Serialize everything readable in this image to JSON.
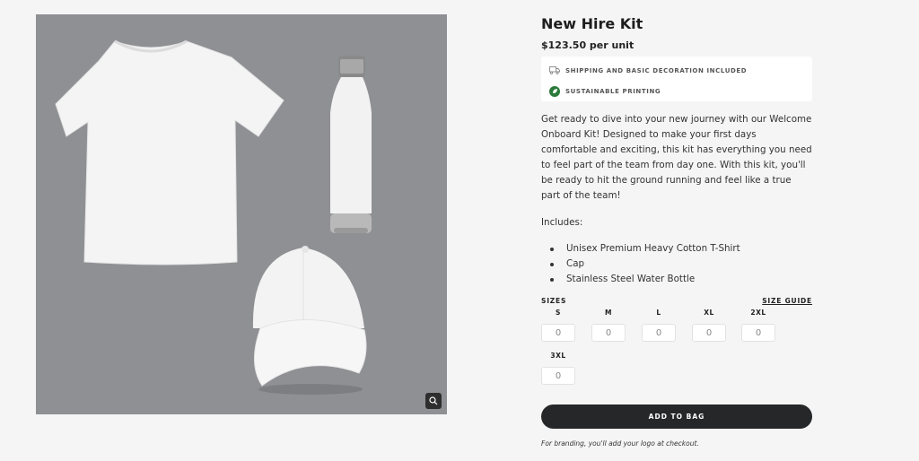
{
  "product": {
    "title": "New Hire Kit",
    "price": "$123.50 per unit",
    "image_bg": "#8f9094",
    "features": [
      {
        "icon": "truck-icon",
        "text": "SHIPPING AND BASIC DECORATION INCLUDED"
      },
      {
        "icon": "leaf-icon",
        "text": "SUSTAINABLE PRINTING"
      }
    ],
    "description": "Get ready to dive into your new journey with our Welcome Onboard Kit! Designed to make your first days comfortable and exciting, this kit has everything you need to feel part of the team from day one. With this kit, you'll be ready to hit the ground running and feel like a true part of the team!",
    "includes_label": "Includes:",
    "includes": [
      "Unisex Premium Heavy Cotton T-Shirt",
      "Cap",
      "Stainless Steel Water Bottle"
    ]
  },
  "sizes": {
    "label": "SIZES",
    "guide_label": "SIZE GUIDE",
    "options": [
      {
        "size": "S",
        "value": "0"
      },
      {
        "size": "M",
        "value": "0"
      },
      {
        "size": "L",
        "value": "0"
      },
      {
        "size": "XL",
        "value": "0"
      },
      {
        "size": "2XL",
        "value": "0"
      },
      {
        "size": "3XL",
        "value": "0"
      }
    ]
  },
  "actions": {
    "add_to_bag": "ADD TO BAG",
    "footnote": "For branding, you'll add your logo at checkout."
  },
  "colors": {
    "button": "#262728",
    "leaf": "#2a7a3a"
  }
}
